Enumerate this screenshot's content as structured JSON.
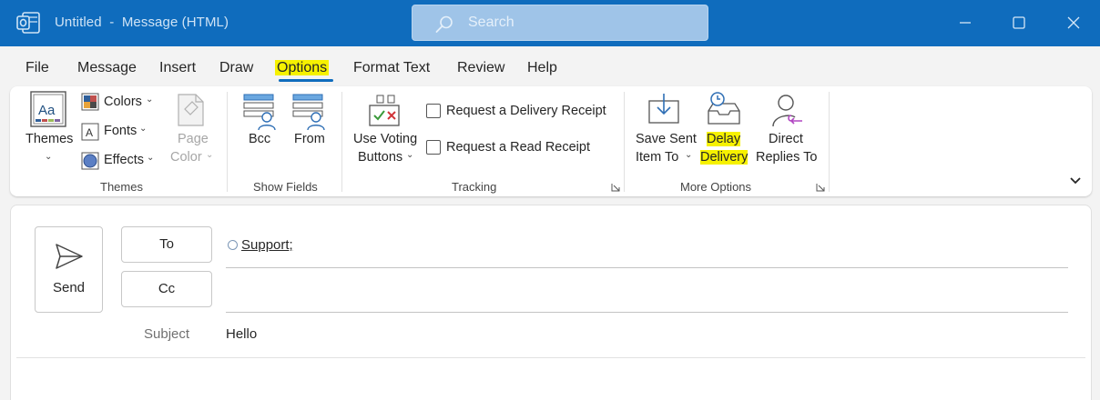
{
  "window": {
    "title": "Untitled  -  Message (HTML)",
    "search_placeholder": "Search",
    "accent": "#0f6cbd"
  },
  "menu": {
    "items": [
      "File",
      "Message",
      "Insert",
      "Draw",
      "Options",
      "Format Text",
      "Review",
      "Help"
    ],
    "active": "Options"
  },
  "ribbon": {
    "themes_group": {
      "label": "Themes",
      "themes_button": "Themes",
      "colors": "Colors",
      "fonts": "Fonts",
      "effects": "Effects",
      "page_color_line1": "Page",
      "page_color_line2": "Color"
    },
    "show_fields_group": {
      "label": "Show Fields",
      "bcc": "Bcc",
      "from": "From"
    },
    "tracking_group": {
      "label": "Tracking",
      "voting_line1": "Use Voting",
      "voting_line2": "Buttons",
      "delivery_receipt": "Request a Delivery Receipt",
      "read_receipt": "Request a Read Receipt",
      "delivery_receipt_checked": false,
      "read_receipt_checked": false
    },
    "more_options_group": {
      "label": "More Options",
      "save_sent_line1": "Save Sent",
      "save_sent_line2": "Item To",
      "delay_line1": "Delay",
      "delay_line2": "Delivery",
      "direct_line1": "Direct",
      "direct_line2": "Replies To"
    },
    "highlight_color": "#f6f100"
  },
  "compose": {
    "send": "Send",
    "to_button": "To",
    "cc_button": "Cc",
    "to_recipients": [
      "Support;"
    ],
    "subject_label": "Subject",
    "subject_value": "Hello"
  }
}
